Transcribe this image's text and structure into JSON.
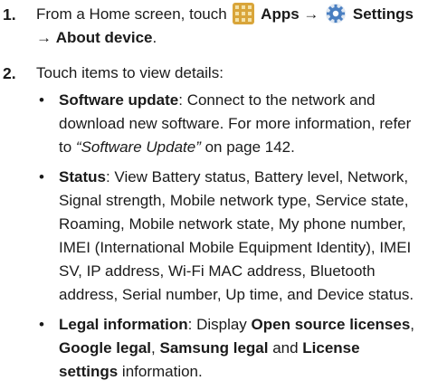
{
  "steps": [
    {
      "number": "1.",
      "prefix": "From a Home screen, touch",
      "apps_icon": "apps-grid-icon",
      "apps_label": "Apps",
      "arrow": "→",
      "settings_icon": "settings-gear-icon",
      "settings_label": "Settings",
      "arrow2": "→",
      "about_label": "About device",
      "end": "."
    },
    {
      "number": "2.",
      "text": "Touch items to view details:"
    }
  ],
  "bullets": [
    {
      "term": "Software update",
      "text": ": Connect to the network and download new software. For more information, refer to ",
      "ref": "“Software Update”",
      "tail": " on page 142."
    },
    {
      "term": "Status",
      "text": ": View Battery status, Battery level, Network, Signal strength, Mobile network type, Service state, Roaming, Mobile network state, My phone number, IMEI (International Mobile Equipment Identity), IMEI SV, IP address, Wi-Fi MAC address, Bluetooth address, Serial number, Up time, and Device status."
    },
    {
      "term": "Legal information",
      "text_a": ": Display ",
      "b1": "Open source licenses",
      "c1": ", ",
      "b2": "Google legal",
      "c2": ", ",
      "b3": "Samsung legal",
      "c3": " and ",
      "b4": "License settings",
      "tail": " information."
    }
  ],
  "bullet_glyph": "•",
  "colors": {
    "apps_icon_bg": "#d9a53a",
    "apps_icon_cell": "#f4e2a8",
    "settings_icon_bg": "#4a7fc1",
    "text": "#1a1a1a"
  }
}
